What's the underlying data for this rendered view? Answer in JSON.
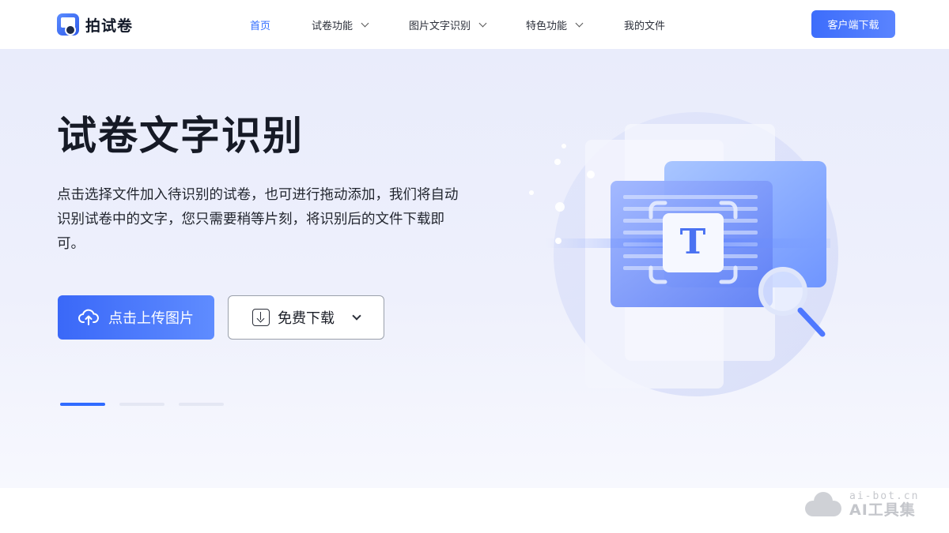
{
  "header": {
    "logo_text": "拍试卷",
    "nav": [
      {
        "label": "首页",
        "active": true,
        "has_dropdown": false
      },
      {
        "label": "试卷功能",
        "active": false,
        "has_dropdown": true
      },
      {
        "label": "图片文字识别",
        "active": false,
        "has_dropdown": true
      },
      {
        "label": "特色功能",
        "active": false,
        "has_dropdown": true
      },
      {
        "label": "我的文件",
        "active": false,
        "has_dropdown": false
      }
    ],
    "client_download_label": "客户端下载"
  },
  "hero": {
    "title": "试卷文字识别",
    "description": "点击选择文件加入待识别的试卷，也可进行拖动添加，我们将自动识别试卷中的文字，您只需要稍等片刻，将识别后的文件下载即可。",
    "upload_button_label": "点击上传图片",
    "download_button_label": "免费下载",
    "illustration_letter": "T",
    "carousel_active_index": 0,
    "carousel_count": 3
  },
  "watermark": {
    "url": "ai-bot.cn",
    "name": "AI工具集"
  },
  "colors": {
    "accent": "#2f6bff",
    "button_gradient_start": "#3a68f8",
    "button_gradient_end": "#5f8cff",
    "hero_bg": "#eef0fc"
  },
  "icons": {
    "upload": "cloud-upload-icon",
    "download": "download-icon",
    "dropdown": "chevron-down-icon",
    "illustration_search": "magnifier-icon"
  }
}
